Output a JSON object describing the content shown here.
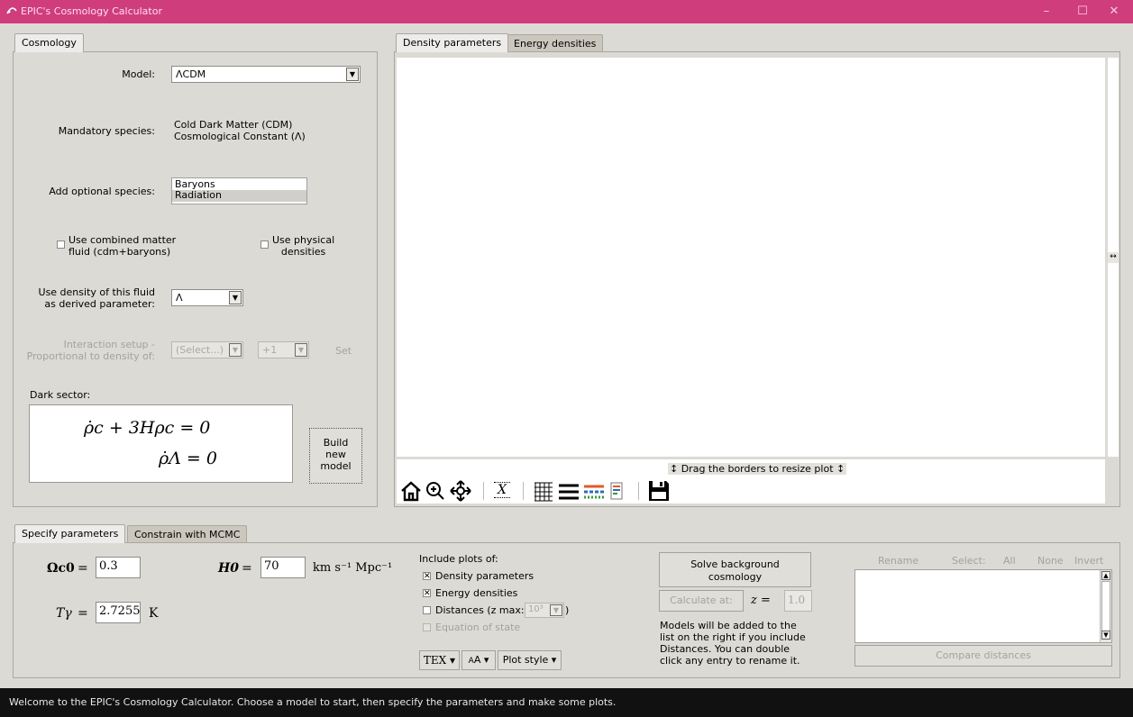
{
  "window": {
    "title": "EPIC's Cosmology Calculator",
    "minimize": "–",
    "maximize": "☐",
    "close": "✕"
  },
  "cosmology": {
    "tab": "Cosmology",
    "model_label": "Model:",
    "model_value": "ΛCDM",
    "mandatory_label": "Mandatory species:",
    "mandatory_line1": "Cold Dark Matter (CDM)",
    "mandatory_line2": "Cosmological Constant (Λ)",
    "optional_label": "Add optional species:",
    "optional_items": [
      "Baryons",
      "Radiation"
    ],
    "combined_label_1": "Use combined matter",
    "combined_label_2": "fluid (cdm+baryons)",
    "physical_label_1": "Use physical",
    "physical_label_2": "densities",
    "derived_label_1": "Use density of this fluid",
    "derived_label_2": "as derived parameter:",
    "derived_value": "Λ",
    "interaction_label_1": "Interaction setup -",
    "interaction_label_2": "Proportional to density of:",
    "interaction_select": "(Select...)",
    "interaction_sign": "+1",
    "interaction_set": "Set",
    "dark_sector_label": "Dark sector:",
    "equation_1": "ρ̇c + 3Hρc = 0",
    "equation_2": "ρ̇Λ = 0",
    "build_btn_1": "Build",
    "build_btn_2": "new",
    "build_btn_3": "model"
  },
  "plot": {
    "tab_density": "Density parameters",
    "tab_energy": "Energy densities",
    "resize_hint": "↕ Drag the borders to resize plot ↕",
    "side_handle": "↔",
    "x_tool": "X"
  },
  "params": {
    "tab_specify": "Specify parameters",
    "tab_mcmc": "Constrain with MCMC",
    "omega_label": "Ωc0",
    "omega_value": "0.3",
    "h0_label": "H0",
    "h0_value": "70",
    "h0_unit": "km s⁻¹ Mpc⁻¹",
    "tgamma_label": "Tγ",
    "tgamma_value": "2.7255",
    "tgamma_unit": "K",
    "equals": "="
  },
  "include": {
    "title": "Include plots of:",
    "density": "Density parameters",
    "energy": "Energy densities",
    "distances": "Distances (z max:",
    "zmax": "10³",
    "distances_close": ")",
    "eos": "Equation of state",
    "tex_btn": "TEX ▾",
    "font_btn": "A ▾",
    "style_btn": "Plot style ▾"
  },
  "solve": {
    "btn_1": "Solve background",
    "btn_2": "cosmology",
    "calc_btn": "Calculate at:",
    "z_label": "z =",
    "z_value": "1.0",
    "note_1": "Models will be added to the",
    "note_2": "list on the right if you include",
    "note_3": "Distances. You can double",
    "note_4": "click any entry to rename it."
  },
  "models": {
    "rename": "Rename",
    "select": "Select:",
    "all": "All",
    "none": "None",
    "invert": "Invert",
    "compare": "Compare distances"
  },
  "status": "Welcome to the EPIC's Cosmology Calculator. Choose a model to start, then specify the parameters and make some plots."
}
